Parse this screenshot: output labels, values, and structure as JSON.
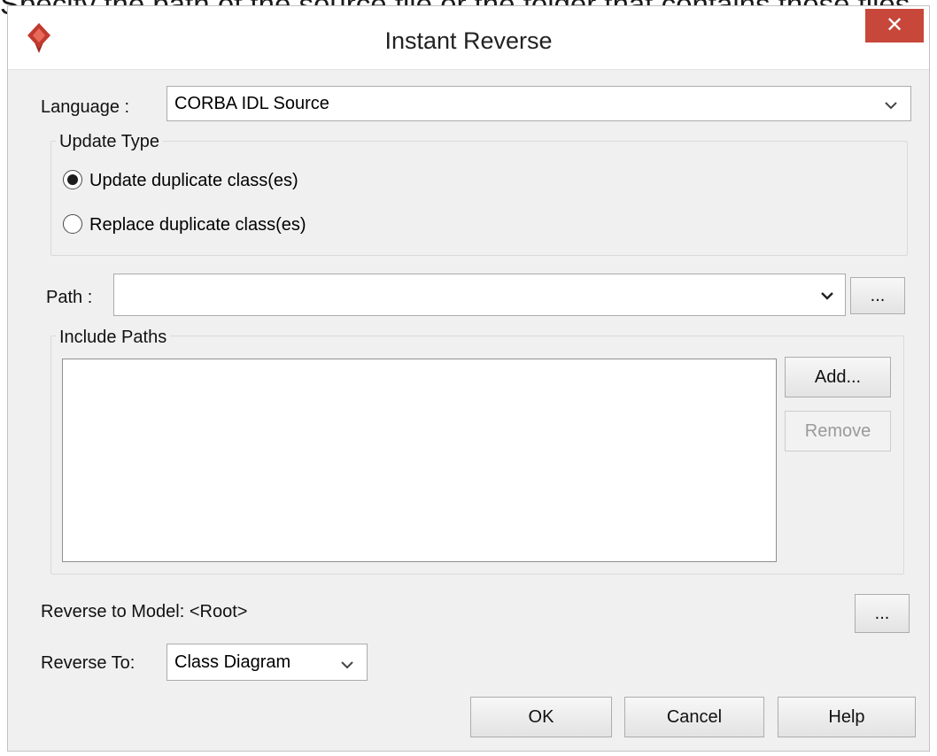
{
  "caption": "Specify the path of the source file or the folder that contains those files.",
  "window": {
    "title": "Instant Reverse",
    "close_glyph": "✕"
  },
  "language": {
    "label": "Language :",
    "value": "CORBA IDL Source"
  },
  "update_type": {
    "title": "Update Type",
    "options": [
      {
        "label": "Update duplicate class(es)",
        "selected": true
      },
      {
        "label": "Replace duplicate class(es)",
        "selected": false
      }
    ]
  },
  "path": {
    "label": "Path :",
    "value": "",
    "browse_label": "..."
  },
  "include_paths": {
    "title": "Include Paths",
    "items": [],
    "add_label": "Add...",
    "remove_label": "Remove"
  },
  "reverse_model": {
    "label": "Reverse to Model: <Root>",
    "browse_label": "..."
  },
  "reverse_to": {
    "label": "Reverse To:",
    "value": "Class Diagram"
  },
  "footer": {
    "ok_label": "OK",
    "cancel_label": "Cancel",
    "help_label": "Help"
  },
  "icons": {
    "app": "visual-paradigm-logo-icon",
    "close": "close-icon",
    "dropdown": "chevron-down-icon"
  },
  "colors": {
    "close_button": "#c7473a",
    "app_logo": "#c23a2e",
    "dialog_bg": "#f0f0f0"
  }
}
